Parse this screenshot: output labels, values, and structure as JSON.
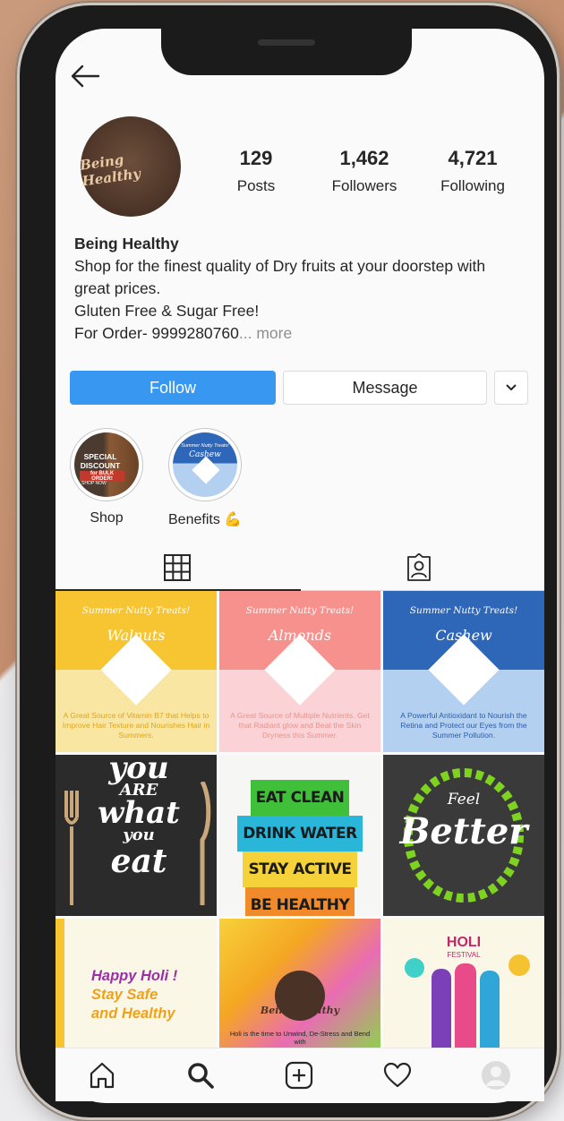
{
  "profile": {
    "avatar_text": "Being Healthy",
    "stats": [
      {
        "value": "129",
        "label": "Posts"
      },
      {
        "value": "1,462",
        "label": "Followers"
      },
      {
        "value": "4,721",
        "label": "Following"
      }
    ],
    "name": "Being Healthy",
    "bio_lines": [
      "Shop for the finest quality of Dry fruits at your doorstep with",
      "great prices.",
      "Gluten Free & Sugar Free!"
    ],
    "bio_last": "For Order- 9999280760",
    "bio_more": "... more"
  },
  "actions": {
    "follow": "Follow",
    "message": "Message"
  },
  "highlights": [
    {
      "label": "Shop",
      "cover_title": "SPECIAL DISCOUNT",
      "cover_sub": "for BULK ORDER!",
      "cover_cta": "SHOP NOW"
    },
    {
      "label": "Benefits 💪",
      "cover_brand": "Summer Nutty Treats!",
      "cover_title": "Cashew"
    }
  ],
  "posts": [
    {
      "brand": "Summer Nutty Treats!",
      "title": "Walnuts",
      "desc": "A Great Source of Vitamin B7 that Helps to Improve Hair Texture and Nourishes Hair in Summers.",
      "color": "#f7c531",
      "lower": "#fae6a3",
      "desc_color": "#e0a51a"
    },
    {
      "brand": "Summer Nutty Treats!",
      "title": "Almonds",
      "desc": "A Great Source of Multiple Nutrients. Get that Radiant glow and Beat the Skin Dryness this Summer.",
      "color": "#f6918d",
      "lower": "#fbd3d6",
      "desc_color": "#e8928c"
    },
    {
      "brand": "Summer Nutty Treats!",
      "title": "Cashew",
      "desc": "A Powerful Antioxidant to Nourish the Retina and Protect our Eyes from the Summer Pollution.",
      "color": "#2f67b8",
      "lower": "#b4d0f0",
      "desc_color": "#2a5daa"
    },
    {
      "lines": [
        "you",
        "ARE",
        "what",
        "you",
        "eat"
      ]
    },
    {
      "lines": [
        "EAT CLEAN",
        "DRINK WATER",
        "STAY ACTIVE",
        "BE HEALTHY"
      ]
    },
    {
      "small": "Feel",
      "big": "Better"
    },
    {
      "lines": [
        "Happy Holi !",
        "Stay Safe",
        "and Healthy"
      ]
    },
    {
      "brand": "Being Healthy",
      "caption": "Holi is the time to Unwind, De-Stress and Bend with"
    },
    {
      "title": "HOLI",
      "sub": "FESTIVAL"
    }
  ],
  "icons": {
    "back": "back-arrow-icon",
    "dropdown": "chevron-down-icon",
    "grid": "grid-icon",
    "tagged": "tagged-icon",
    "home": "home-icon",
    "search": "search-icon",
    "add": "add-post-icon",
    "activity": "heart-icon",
    "profile": "profile-icon"
  },
  "colors": {
    "accent": "#3897f0",
    "text": "#262626",
    "muted": "#8e8e8e"
  }
}
